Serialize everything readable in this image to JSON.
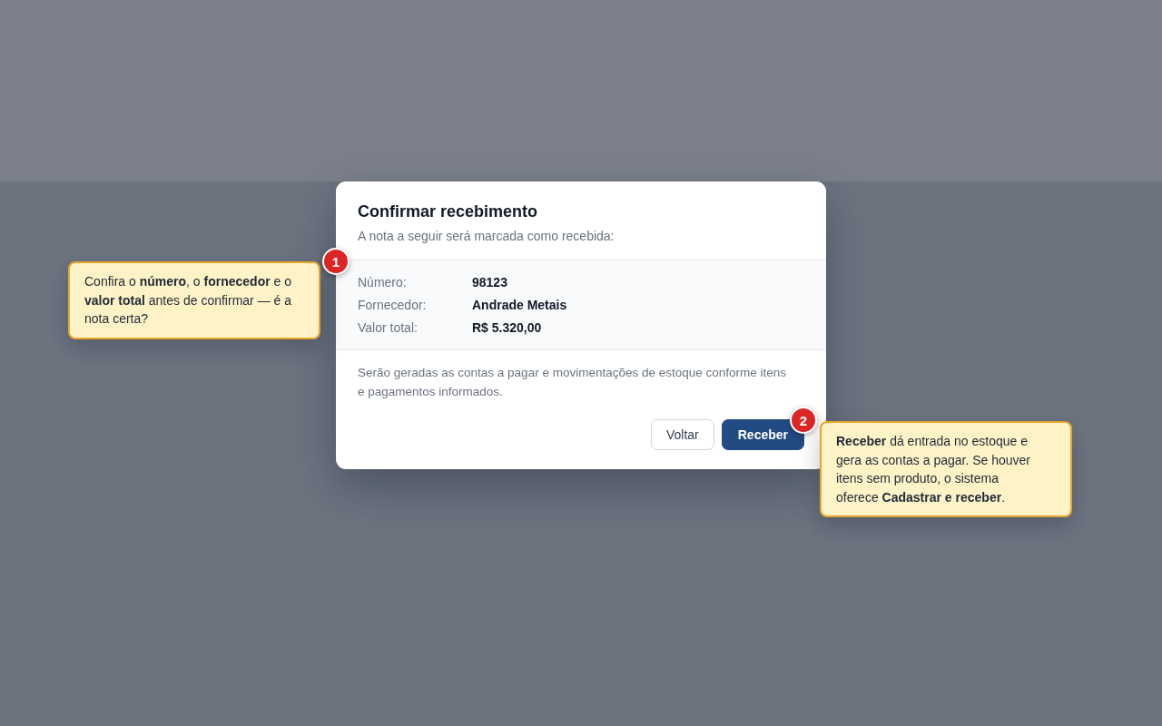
{
  "dialog": {
    "title": "Confirmar recebimento",
    "subtitle": "A nota a seguir será marcada como recebida:",
    "details": [
      {
        "label": "Número:",
        "value": "98123"
      },
      {
        "label": "Fornecedor:",
        "value": "Andrade Metais"
      },
      {
        "label": "Valor total:",
        "value": "R$ 5.320,00"
      }
    ],
    "note": "Serão geradas as contas a pagar e movimentações de estoque conforme itens e pagamentos informados.",
    "buttons": [
      {
        "label": "Voltar",
        "kind": "secondary"
      },
      {
        "label": "Receber",
        "kind": "primary"
      }
    ]
  },
  "callouts": [
    {
      "number": "1",
      "text": "Confira o **número**, o **fornecedor** e o **valor total** antes de confirmar — é a nota certa?"
    },
    {
      "number": "2",
      "text": "**Receber** dá entrada no estoque e gera as contas a pagar. Se houver itens sem produto, o sistema oferece **Cadastrar e receber**."
    }
  ]
}
